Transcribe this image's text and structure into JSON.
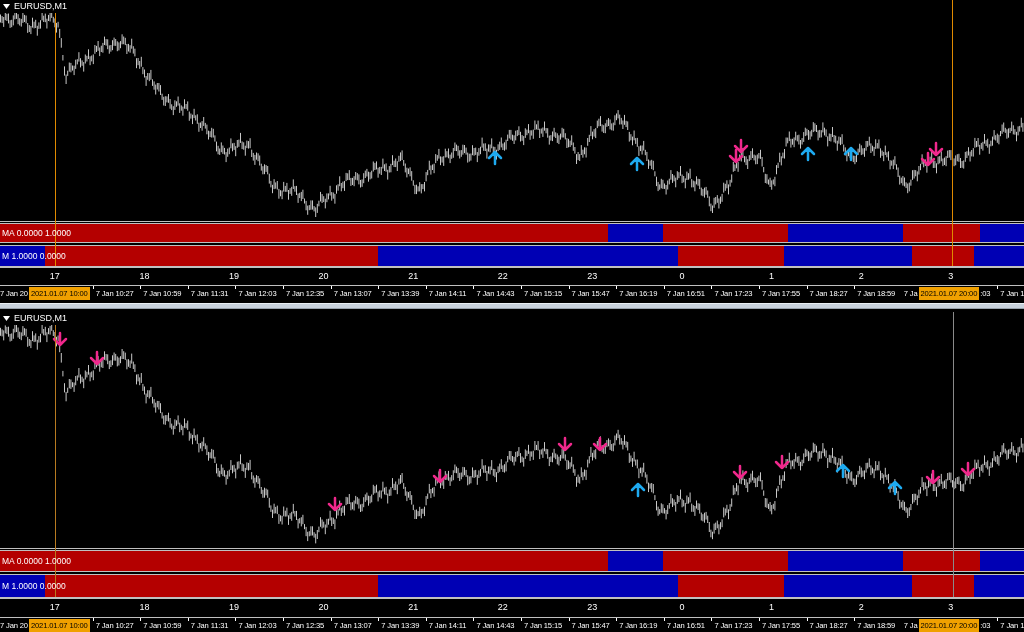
{
  "panels": [
    {
      "title": "EURUSD,M1",
      "signals": [
        {
          "kind": "up"
        },
        {
          "kind": "up"
        },
        {
          "kind": "down"
        },
        {
          "kind": "down"
        },
        {
          "kind": "up"
        },
        {
          "kind": "up"
        },
        {
          "kind": "down"
        },
        {
          "kind": "down"
        }
      ],
      "indicators": [
        {
          "label": "MA 0.0000 1.0000",
          "segments": [
            {
              "color": "#b40000"
            },
            {
              "color": "#0000b4"
            },
            {
              "color": "#b40000"
            },
            {
              "color": "#0000b4"
            },
            {
              "color": "#b40000"
            },
            {
              "color": "#0000b4"
            }
          ]
        },
        {
          "label": "M 1.0000 0.0000",
          "segments": [
            {
              "color": "#0000b4"
            },
            {
              "color": "#b40000"
            },
            {
              "color": "#0000b4"
            },
            {
              "color": "#b40000"
            },
            {
              "color": "#0000b4"
            },
            {
              "color": "#b40000"
            },
            {
              "color": "#0000b4"
            }
          ]
        }
      ],
      "hours": [
        "17",
        "18",
        "19",
        "20",
        "21",
        "22",
        "23",
        "0",
        "1",
        "2",
        "3"
      ],
      "time_axis": [
        {
          "kind": "cut",
          "text": "7 Jan 20"
        },
        {
          "kind": "cursor",
          "text": "2021.01.07 10:00"
        },
        {
          "kind": "label",
          "text": "7 Jan 10:27"
        },
        {
          "kind": "label",
          "text": "7 Jan 10:59"
        },
        {
          "kind": "label",
          "text": "7 Jan 11:31"
        },
        {
          "kind": "label",
          "text": "7 Jan 12:03"
        },
        {
          "kind": "label",
          "text": "7 Jan 12:35"
        },
        {
          "kind": "label",
          "text": "7 Jan 13:07"
        },
        {
          "kind": "label",
          "text": "7 Jan 13:39"
        },
        {
          "kind": "label",
          "text": "7 Jan 14:11"
        },
        {
          "kind": "label",
          "text": "7 Jan 14:43"
        },
        {
          "kind": "label",
          "text": "7 Jan 15:15"
        },
        {
          "kind": "label",
          "text": "7 Jan 15:47"
        },
        {
          "kind": "label",
          "text": "7 Jan 16:19"
        },
        {
          "kind": "label",
          "text": "7 Jan 16:51"
        },
        {
          "kind": "label",
          "text": "7 Jan 17:23"
        },
        {
          "kind": "label",
          "text": "7 Jan 17:55"
        },
        {
          "kind": "label",
          "text": "7 Jan 18:27"
        },
        {
          "kind": "label",
          "text": "7 Jan 18:59"
        },
        {
          "kind": "cut",
          "text": "7 Ja"
        },
        {
          "kind": "cursor",
          "text": "2021.01.07 20:00"
        },
        {
          "kind": "cut",
          "text": ":03"
        },
        {
          "kind": "label",
          "text": "7 Jan 1"
        }
      ]
    },
    {
      "title": "EURUSD,M1",
      "signals": [
        {
          "kind": "down"
        },
        {
          "kind": "down"
        },
        {
          "kind": "down"
        },
        {
          "kind": "down"
        },
        {
          "kind": "down"
        },
        {
          "kind": "down"
        },
        {
          "kind": "up"
        },
        {
          "kind": "down"
        },
        {
          "kind": "down"
        },
        {
          "kind": "up"
        },
        {
          "kind": "up"
        },
        {
          "kind": "down"
        },
        {
          "kind": "down"
        }
      ],
      "indicators": [
        {
          "label": "MA 0.0000 1.0000",
          "segments": [
            {
              "color": "#b40000"
            },
            {
              "color": "#0000b4"
            },
            {
              "color": "#b40000"
            },
            {
              "color": "#0000b4"
            },
            {
              "color": "#b40000"
            },
            {
              "color": "#0000b4"
            }
          ]
        },
        {
          "label": "M 1.0000 0.0000",
          "segments": [
            {
              "color": "#0000b4"
            },
            {
              "color": "#b40000"
            },
            {
              "color": "#0000b4"
            },
            {
              "color": "#b40000"
            },
            {
              "color": "#0000b4"
            },
            {
              "color": "#b40000"
            },
            {
              "color": "#0000b4"
            }
          ]
        }
      ],
      "hours": [
        "17",
        "18",
        "19",
        "20",
        "21",
        "22",
        "23",
        "0",
        "1",
        "2",
        "3"
      ],
      "time_axis": [
        {
          "kind": "cut",
          "text": "7 Jan 20"
        },
        {
          "kind": "cursor",
          "text": "2021.01.07 10:00"
        },
        {
          "kind": "label",
          "text": "7 Jan 10:27"
        },
        {
          "kind": "label",
          "text": "7 Jan 10:59"
        },
        {
          "kind": "label",
          "text": "7 Jan 11:31"
        },
        {
          "kind": "label",
          "text": "7 Jan 12:03"
        },
        {
          "kind": "label",
          "text": "7 Jan 12:35"
        },
        {
          "kind": "label",
          "text": "7 Jan 13:07"
        },
        {
          "kind": "label",
          "text": "7 Jan 13:39"
        },
        {
          "kind": "label",
          "text": "7 Jan 14:11"
        },
        {
          "kind": "label",
          "text": "7 Jan 14:43"
        },
        {
          "kind": "label",
          "text": "7 Jan 15:15"
        },
        {
          "kind": "label",
          "text": "7 Jan 15:47"
        },
        {
          "kind": "label",
          "text": "7 Jan 16:19"
        },
        {
          "kind": "label",
          "text": "7 Jan 16:51"
        },
        {
          "kind": "label",
          "text": "7 Jan 17:23"
        },
        {
          "kind": "label",
          "text": "7 Jan 17:55"
        },
        {
          "kind": "label",
          "text": "7 Jan 18:27"
        },
        {
          "kind": "label",
          "text": "7 Jan 18:59"
        },
        {
          "kind": "cut",
          "text": "7 Ja"
        },
        {
          "kind": "cursor",
          "text": "2021.01.07 20:00"
        },
        {
          "kind": "cut",
          "text": ":03"
        },
        {
          "kind": "label",
          "text": "7 Jan 1"
        }
      ]
    }
  ]
}
